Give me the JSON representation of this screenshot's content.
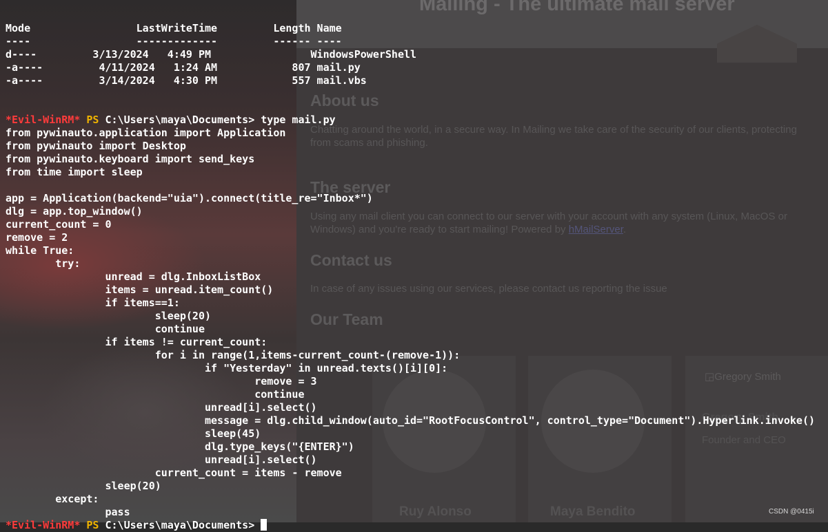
{
  "website": {
    "title": "Mailing - The ultimate mail server",
    "sections": [
      {
        "heading": "About us",
        "lines": [
          "Chatting around the world, in a secure way. In Mailing we take care of the security of our clients, protecting",
          "from scams and phishing."
        ]
      },
      {
        "heading": "The server",
        "lines": [
          "Using any mail client you can connect to our server with your account with any system (Linux, MacOS or",
          "Windows) and you're ready to start mailing! Powered by "
        ],
        "link": "hMailServer",
        "after_link": "."
      },
      {
        "heading": "Contact us",
        "lines": [
          "In case of any issues using our services, please contact us reporting the issue"
        ]
      },
      {
        "heading": "Our Team",
        "lines": []
      }
    ],
    "team": {
      "members": [
        "Ruy Alonso",
        "Maya Bendito"
      ],
      "broken_image_alt": "Gregory Smith",
      "third_name": "Gregory Smith",
      "third_role": "Founder and CEO"
    }
  },
  "terminal": {
    "listing_header": "Mode                 LastWriteTime         Length Name",
    "listing_rule": "----                 -------------         ------ ----",
    "listing_rows": [
      "d----         3/13/2024   4:49 PM                WindowsPowerShell",
      "-a----         4/11/2024   1:24 AM            807 mail.py",
      "-a----         3/14/2024   4:30 PM            557 mail.vbs"
    ],
    "prompt_tag": "*Evil-WinRM*",
    "prompt_ps": "PS",
    "prompt_path": "C:\\Users\\maya\\Documents>",
    "command": "type mail.py",
    "code_lines": [
      "from pywinauto.application import Application",
      "from pywinauto import Desktop",
      "from pywinauto.keyboard import send_keys",
      "from time import sleep",
      "",
      "app = Application(backend=\"uia\").connect(title_re=\"Inbox*\")",
      "dlg = app.top_window()",
      "current_count = 0",
      "remove = 2",
      "while True:",
      "        try:",
      "                unread = dlg.InboxListBox",
      "                items = unread.item_count()",
      "                if items==1:",
      "                        sleep(20)",
      "                        continue",
      "                if items != current_count:",
      "                        for i in range(1,items-current_count-(remove-1)):",
      "                                if \"Yesterday\" in unread.texts()[i][0]:",
      "                                        remove = 3",
      "                                        continue",
      "                                unread[i].select()",
      "                                message = dlg.child_window(auto_id=\"RootFocusControl\", control_type=\"Document\").Hyperlink.invoke()",
      "                                sleep(45)",
      "                                dlg.type_keys(\"{ENTER}\")",
      "                                unread[i].select()",
      "                        current_count = items - remove",
      "                sleep(20)",
      "        except:",
      "                pass"
    ]
  },
  "watermark": "CSDN @0415i"
}
